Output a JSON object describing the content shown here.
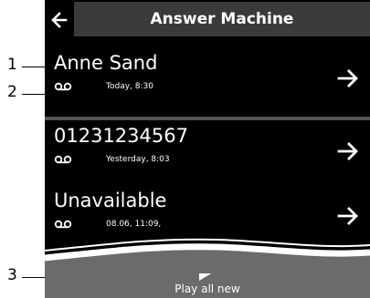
{
  "header": {
    "title": "Answer Machine"
  },
  "messages": [
    {
      "caller": "Anne Sand",
      "timestamp": "Today, 8:30"
    },
    {
      "caller": "01231234567",
      "timestamp": "Yesterday, 8:03"
    },
    {
      "caller": "Unavailable",
      "timestamp": "08.06, 11:09,"
    }
  ],
  "footer": {
    "play_label": "Play all new"
  },
  "callouts": [
    "1",
    "2",
    "3"
  ],
  "icons": {
    "back": "arrow-left-icon",
    "open": "arrow-right-icon",
    "voicemail": "voicemail-icon",
    "play": "play-icon"
  },
  "colors": {
    "background": "#000000",
    "title_bar": "#3a3a3a",
    "separator": "#555555",
    "footer": "#6b6b6b",
    "text": "#ffffff"
  }
}
